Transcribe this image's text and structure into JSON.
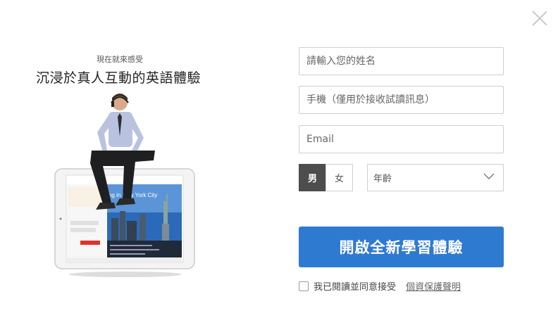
{
  "left": {
    "subtitle": "現在就來感受",
    "title": "沉浸於真人互動的英語體驗",
    "screen_caption": "ng in New York City"
  },
  "form": {
    "name_placeholder": "請輸入您的姓名",
    "phone_placeholder": "手機（僅用於接收試讀訊息）",
    "email_placeholder": "Email",
    "gender_male": "男",
    "gender_female": "女",
    "gender_selected": "男",
    "age_placeholder": "年齡",
    "submit_label": "開啟全新學習體驗",
    "agree_label": "我已閱讀並同意接受",
    "privacy_link": "個資保護聲明"
  },
  "icons": {
    "close": "close-icon",
    "age_dropdown": "chevron-down-icon",
    "checkbox": "checkbox-icon"
  },
  "colors": {
    "primary": "#2f7ad1",
    "selected_gender": "#4d4d4d"
  }
}
